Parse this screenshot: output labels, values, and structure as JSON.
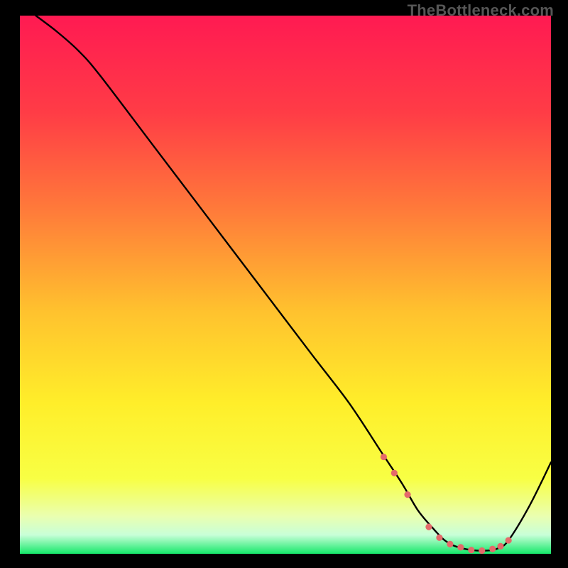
{
  "watermark": "TheBottleneck.com",
  "chart_data": {
    "type": "line",
    "title": "",
    "xlabel": "",
    "ylabel": "",
    "xlim": [
      0,
      100
    ],
    "ylim": [
      0,
      100
    ],
    "gradient_stops": [
      {
        "t": 0.0,
        "color": "#ff1a52"
      },
      {
        "t": 0.18,
        "color": "#ff3c46"
      },
      {
        "t": 0.36,
        "color": "#ff7a3a"
      },
      {
        "t": 0.55,
        "color": "#ffc22e"
      },
      {
        "t": 0.72,
        "color": "#ffee2a"
      },
      {
        "t": 0.86,
        "color": "#f8ff44"
      },
      {
        "t": 0.93,
        "color": "#eaffb0"
      },
      {
        "t": 0.965,
        "color": "#c8ffd8"
      },
      {
        "t": 1.0,
        "color": "#15e86a"
      }
    ],
    "series": [
      {
        "name": "bottleneck-curve",
        "color": "#000000",
        "x": [
          3,
          7,
          11,
          15,
          25,
          35,
          45,
          55,
          62,
          68,
          72,
          75,
          78,
          80,
          82,
          85,
          88,
          90,
          92,
          96,
          100
        ],
        "y": [
          100,
          97,
          93.5,
          89,
          76,
          63,
          50,
          37,
          28,
          19,
          13,
          8,
          4.5,
          2.5,
          1.4,
          0.7,
          0.6,
          1.0,
          2.5,
          9,
          17
        ]
      }
    ],
    "markers": {
      "name": "optimal-zone-markers",
      "color": "#e46a6a",
      "radius": 4.6,
      "x": [
        68.5,
        70.5,
        73.0,
        77.0,
        79.0,
        81.0,
        83.0,
        85.0,
        87.0,
        89.0,
        90.5,
        92.0
      ],
      "y": [
        18.0,
        15.0,
        11.0,
        5.0,
        3.0,
        1.8,
        1.2,
        0.7,
        0.6,
        0.9,
        1.4,
        2.5
      ]
    }
  }
}
